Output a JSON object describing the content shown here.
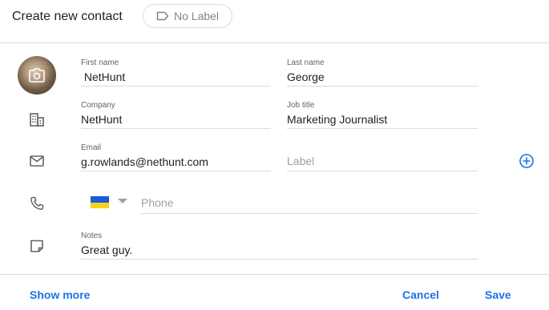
{
  "header": {
    "title": "Create new contact",
    "label_chip": "No Label"
  },
  "fields": {
    "first_name": {
      "label": "First name",
      "value": " NetHunt"
    },
    "last_name": {
      "label": "Last name",
      "value": "George"
    },
    "company": {
      "label": "Company",
      "value": "NetHunt"
    },
    "job_title": {
      "label": "Job title",
      "value": "Marketing Journalist"
    },
    "email": {
      "label": "Email",
      "value": "g.rowlands@nethunt.com"
    },
    "email_label": {
      "placeholder": "Label"
    },
    "phone": {
      "placeholder": "Phone"
    },
    "notes": {
      "label": "Notes",
      "value": "Great guy."
    }
  },
  "footer": {
    "show_more": "Show more",
    "cancel": "Cancel",
    "save": "Save"
  },
  "colors": {
    "accent": "#1a73e8",
    "divider": "#dadce0",
    "flag_blue": "#1a5bd6",
    "flag_yellow": "#f7d21b"
  }
}
